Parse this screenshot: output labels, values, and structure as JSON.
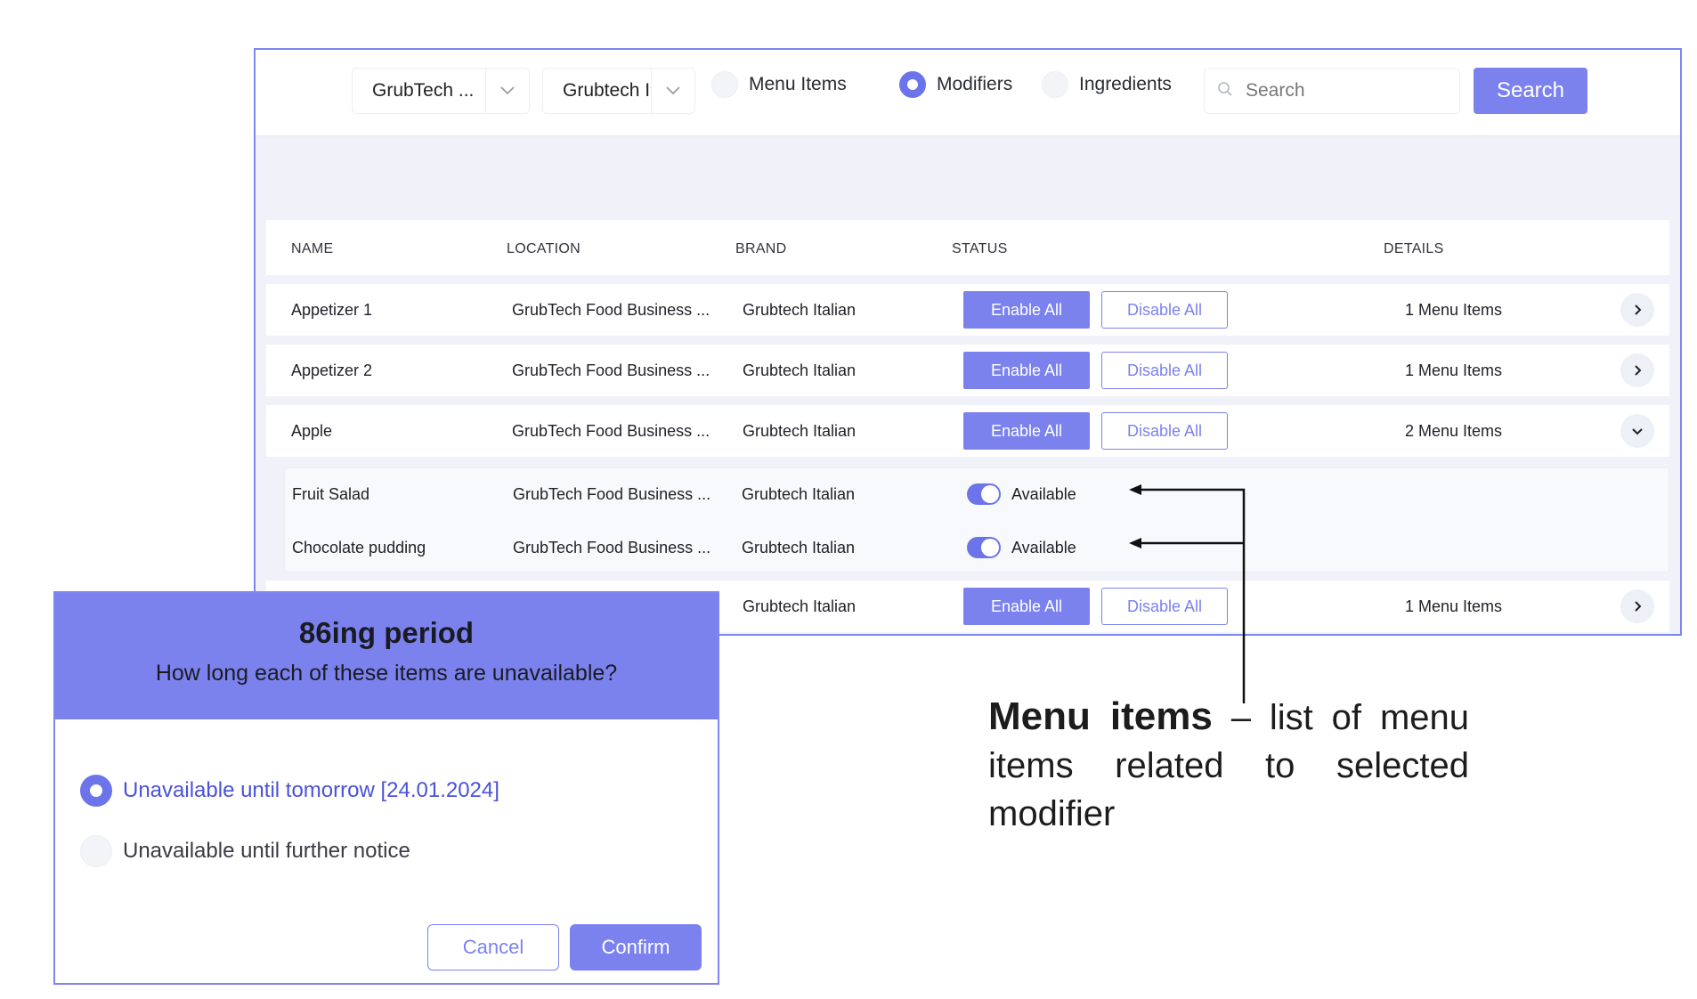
{
  "toolbar": {
    "location_select": "GrubTech ...",
    "brand_select": "Grubtech I...",
    "filter_options": [
      {
        "label": "Menu Items",
        "selected": false
      },
      {
        "label": "Modifiers",
        "selected": true
      },
      {
        "label": "Ingredients",
        "selected": false
      }
    ],
    "search_placeholder": "Search",
    "search_button": "Search"
  },
  "table": {
    "headers": {
      "name": "NAME",
      "location": "LOCATION",
      "brand": "BRAND",
      "status": "STATUS",
      "details": "DETAILS"
    },
    "enable_label": "Enable All",
    "disable_label": "Disable All",
    "rows": [
      {
        "name": "Appetizer 1",
        "location": "GrubTech Food Business ...",
        "brand": "Grubtech Italian",
        "details": "1 Menu Items",
        "expanded": false
      },
      {
        "name": "Appetizer 2",
        "location": "GrubTech Food Business ...",
        "brand": "Grubtech Italian",
        "details": "1 Menu Items",
        "expanded": false
      },
      {
        "name": "Apple",
        "location": "GrubTech Food Business ...",
        "brand": "Grubtech Italian",
        "details": "2 Menu Items",
        "expanded": true
      },
      {
        "name": "",
        "location": "",
        "brand": "Grubtech Italian",
        "details": "1 Menu Items",
        "expanded": false
      }
    ],
    "sub_items": [
      {
        "name": "Fruit Salad",
        "location": "GrubTech Food Business ...",
        "brand": "Grubtech Italian",
        "status": "Available"
      },
      {
        "name": "Chocolate pudding",
        "location": "GrubTech Food Business ...",
        "brand": "Grubtech Italian",
        "status": "Available"
      }
    ]
  },
  "annotation": {
    "bold": "Menu items",
    "text": " – list of menu items related to selected modifier"
  },
  "dialog": {
    "title": "86ing period",
    "subtitle": "How long each of these items are unavailable?",
    "options": [
      {
        "label": "Unavailable until tomorrow [24.01.2024]",
        "selected": true
      },
      {
        "label": "Unavailable until further notice",
        "selected": false
      }
    ],
    "cancel": "Cancel",
    "confirm": "Confirm"
  },
  "colors": {
    "accent": "#7b82ee",
    "accent_dark": "#4a52d9",
    "panel_bg": "#f1f2f9"
  }
}
